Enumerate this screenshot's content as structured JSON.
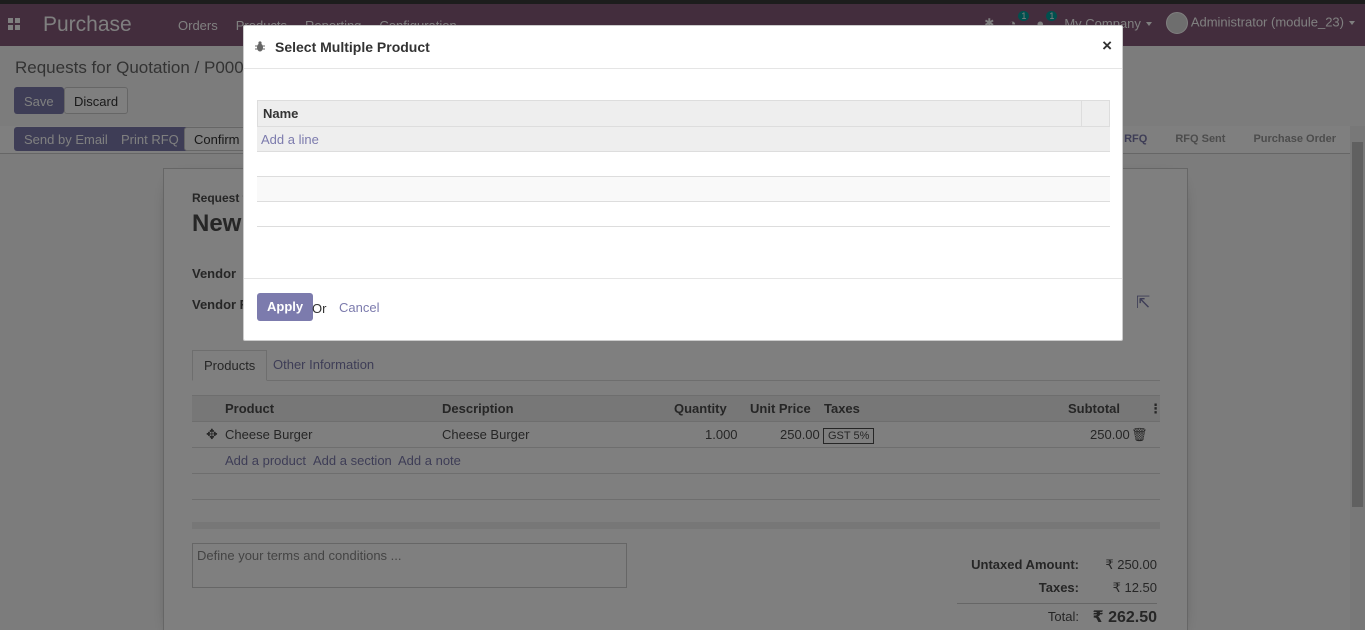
{
  "app": {
    "title": "Purchase"
  },
  "topnav": {
    "items": [
      "Orders",
      "Products",
      "Reporting",
      "Configuration"
    ]
  },
  "topright": {
    "activity_count": "1",
    "messages_count": "1",
    "company": "My Company",
    "user": "Administrator (module_23)"
  },
  "breadcrumb": {
    "parent": "Requests for Quotation",
    "current": "P0000"
  },
  "buttons": {
    "save": "Save",
    "discard": "Discard",
    "send_email": "Send by Email",
    "print_rfq": "Print RFQ",
    "confirm": "Confirm C"
  },
  "stages": [
    "RFQ",
    "RFQ Sent",
    "Purchase Order"
  ],
  "form": {
    "title_label": "Request f",
    "title": "New",
    "vendor_label": "Vendor",
    "vendor_ref_label": "Vendor R",
    "tabs": [
      "Products",
      "Other Information"
    ],
    "columns": {
      "product": "Product",
      "description": "Description",
      "quantity": "Quantity",
      "unit_price": "Unit Price",
      "taxes": "Taxes",
      "subtotal": "Subtotal"
    },
    "line": {
      "product": "Cheese Burger",
      "description": "Cheese Burger",
      "quantity": "1.000",
      "unit_price": "250.00",
      "tax": "GST 5%",
      "subtotal": "250.00"
    },
    "add_product": "Add a product",
    "add_section": "Add a section",
    "add_note": "Add a note",
    "terms_placeholder": "Define your terms and conditions ...",
    "totals": {
      "untaxed_label": "Untaxed Amount:",
      "untaxed": "₹ 250.00",
      "taxes_label": "Taxes:",
      "taxes": "₹ 12.50",
      "total_label": "Total:",
      "total": "₹ 262.50"
    }
  },
  "modal": {
    "title": "Select Multiple Product",
    "column_name": "Name",
    "add_line": "Add a line",
    "apply": "Apply",
    "or": "Or",
    "cancel": "Cancel"
  }
}
